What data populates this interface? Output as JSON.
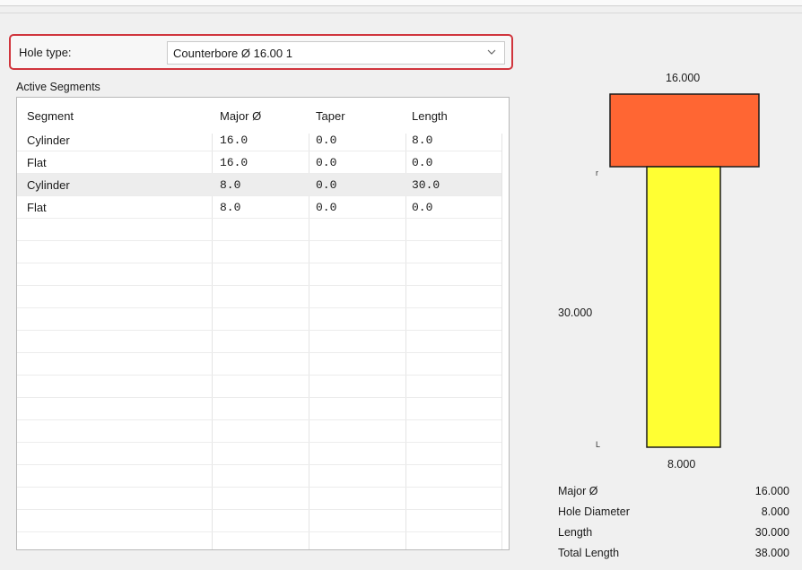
{
  "hole_type": {
    "label": "Hole type:",
    "value": "Counterbore Ø 16.00 1"
  },
  "segments": {
    "caption": "Active Segments",
    "columns": [
      "Segment",
      "Major Ø",
      "Taper",
      "Length"
    ],
    "rows": [
      {
        "segment": "Cylinder",
        "major": "16.0",
        "taper": "0.0",
        "length": "8.0"
      },
      {
        "segment": "Flat",
        "major": "16.0",
        "taper": "0.0",
        "length": "0.0"
      },
      {
        "segment": "Cylinder",
        "major": "8.0",
        "taper": "0.0",
        "length": "30.0"
      },
      {
        "segment": "Flat",
        "major": "8.0",
        "taper": "0.0",
        "length": "0.0"
      }
    ],
    "selected_row_index": 2
  },
  "diagram": {
    "top_dimension": "16.000",
    "side_dimension": "30.000",
    "bottom_dimension": "8.000",
    "marker_top": "r",
    "marker_bottom": "L",
    "colors": {
      "counterbore_fill": "#ff6633",
      "hole_fill": "#ffff33",
      "outline": "#1a1a1a"
    }
  },
  "summary": [
    {
      "label": "Major Ø",
      "value": "16.000"
    },
    {
      "label": "Hole Diameter",
      "value": "8.000"
    },
    {
      "label": "Length",
      "value": "30.000"
    },
    {
      "label": "Total Length",
      "value": "38.000"
    }
  ],
  "colors": {
    "highlight_border": "#d0353d",
    "background": "#f0f0f0"
  }
}
